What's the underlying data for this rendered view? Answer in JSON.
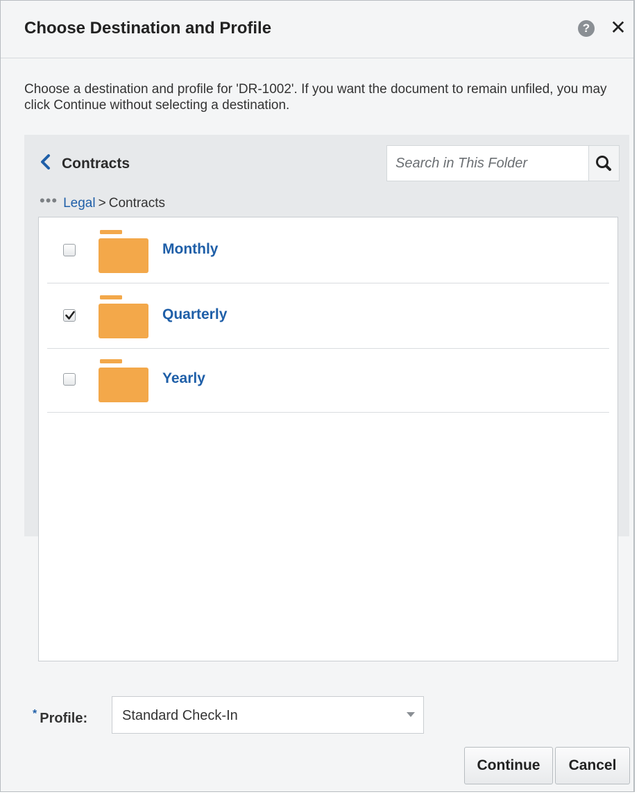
{
  "dialog": {
    "title": "Choose Destination and Profile",
    "instructions": "Choose a destination and profile for 'DR-1002'. If you want the document to remain unfiled, you may click Continue without selecting a destination."
  },
  "browser": {
    "current_folder": "Contracts",
    "search": {
      "placeholder": "Search in This Folder",
      "value": ""
    },
    "breadcrumb": {
      "ellipsis": "•••",
      "parent": "Legal",
      "separator": ">",
      "current": "Contracts"
    },
    "folders": [
      {
        "label": "Monthly",
        "checked": false
      },
      {
        "label": "Quarterly",
        "checked": true
      },
      {
        "label": "Yearly",
        "checked": false
      }
    ]
  },
  "profile": {
    "required_marker": "*",
    "label": "Profile:",
    "selected": "Standard Check-In"
  },
  "buttons": {
    "continue": "Continue",
    "cancel": "Cancel"
  },
  "colors": {
    "link": "#1f5fa8",
    "folder": "#f3a84a",
    "panel": "#e7e9eb"
  },
  "icons": {
    "help": "help-icon",
    "close": "close-icon",
    "back": "chevron-left-icon",
    "search": "search-icon",
    "folder": "folder-icon",
    "dropdown": "chevron-down-icon"
  }
}
